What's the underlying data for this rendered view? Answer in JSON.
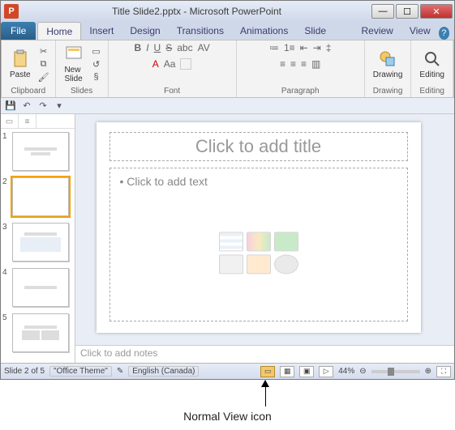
{
  "titlebar": {
    "app_icon_letter": "P",
    "title": "Title Slide2.pptx - Microsoft PowerPoint"
  },
  "tabs": {
    "file": "File",
    "items": [
      "Home",
      "Insert",
      "Design",
      "Transitions",
      "Animations",
      "Slide Show",
      "Review",
      "View"
    ],
    "active": "Home"
  },
  "ribbon": {
    "clipboard": {
      "label": "Clipboard",
      "paste": "Paste"
    },
    "slides": {
      "label": "Slides",
      "new_slide": "New\nSlide"
    },
    "font": {
      "label": "Font"
    },
    "paragraph": {
      "label": "Paragraph"
    },
    "drawing": {
      "label": "Drawing",
      "btn": "Drawing"
    },
    "editing": {
      "label": "Editing",
      "btn": "Editing"
    }
  },
  "thumbs": {
    "count": 5,
    "selected": 2
  },
  "slide": {
    "title_ph": "Click to add title",
    "content_ph": "Click to add text",
    "bullet": "•"
  },
  "notes": {
    "placeholder": "Click to add notes"
  },
  "status": {
    "slide_of": "Slide 2 of 5",
    "theme": "\"Office Theme\"",
    "lang": "English (Canada)",
    "zoom": "44%"
  },
  "annotation": {
    "label": "Normal View icon"
  }
}
